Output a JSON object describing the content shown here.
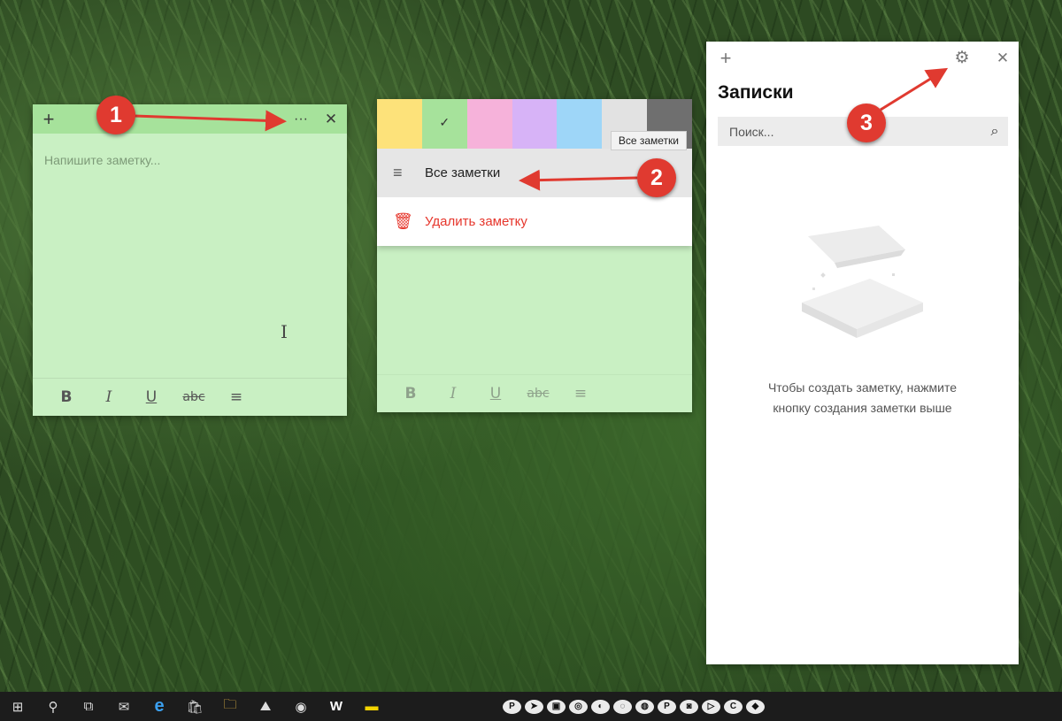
{
  "note1": {
    "add_icon": "+",
    "more_icon": "···",
    "close_icon": "✕",
    "placeholder": "Напишите заметку...",
    "format": {
      "bold": "B",
      "italic": "I",
      "underline": "U",
      "strike": "abc",
      "list_icon": "≡"
    }
  },
  "note2": {
    "colors": [
      "#fde27a",
      "#a6e29b",
      "#f6b2da",
      "#d7b3f7",
      "#9ed6f8",
      "#e2e2e2",
      "#6f6f6f"
    ],
    "selected_color_index": 1,
    "check": "✓",
    "tooltip": "Все заметки",
    "menu": {
      "all_notes": "Все заметки",
      "delete_note": "Удалить заметку"
    },
    "format": {
      "bold": "B",
      "italic": "I",
      "underline": "U",
      "strike": "abc",
      "list_icon": "≡"
    }
  },
  "panel": {
    "add_icon": "+",
    "settings_icon": "⚙",
    "close_icon": "✕",
    "title": "Записки",
    "search_placeholder": "Поиск...",
    "search_icon": "⌕",
    "empty_line1": "Чтобы создать заметку, нажмите",
    "empty_line2": "кнопку создания заметки выше"
  },
  "callouts": [
    "1",
    "2",
    "3"
  ],
  "taskbar": {
    "icons": [
      "windows-start",
      "search",
      "task-view",
      "mail",
      "edge",
      "store",
      "file-explorer",
      "photos",
      "chrome",
      "word",
      "sticky-notes"
    ],
    "glyphs": [
      "⊞",
      "⚲",
      "⧉",
      "✉",
      "e",
      "🛍",
      "🗀",
      "⛰",
      "◉",
      "W",
      "▬"
    ],
    "tray_labels": [
      "P",
      "➤",
      "▣",
      "◎",
      "◐",
      "◌",
      "◍",
      "P",
      "◙",
      "▷",
      "C",
      "◆"
    ]
  },
  "colors": {
    "accent_red": "#e03a30",
    "note_green": "#c9f0c3"
  }
}
